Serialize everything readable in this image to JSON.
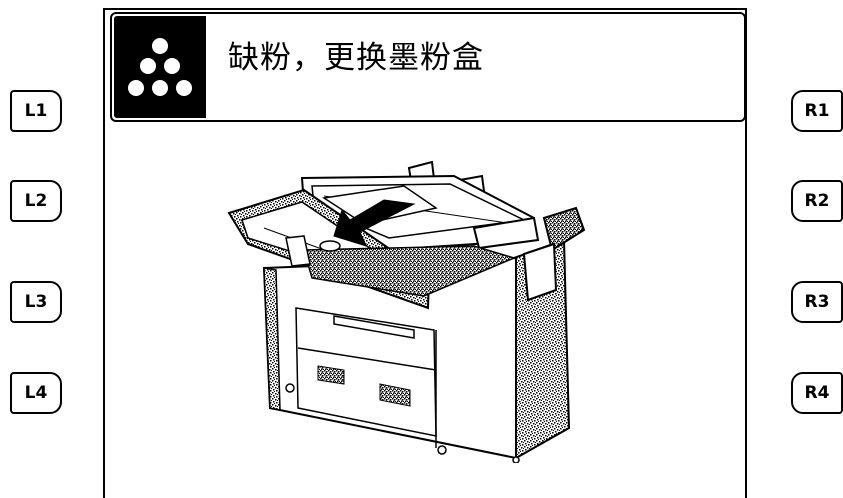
{
  "header": {
    "title": "缺粉，更换墨粉盒",
    "icon": "toner-dots-icon"
  },
  "soft_keys": {
    "left": [
      "L1",
      "L2",
      "L3",
      "L4"
    ],
    "right": [
      "R1",
      "R2",
      "R3",
      "R4"
    ]
  },
  "illustration": {
    "icon": "printer-open-toner-icon"
  }
}
